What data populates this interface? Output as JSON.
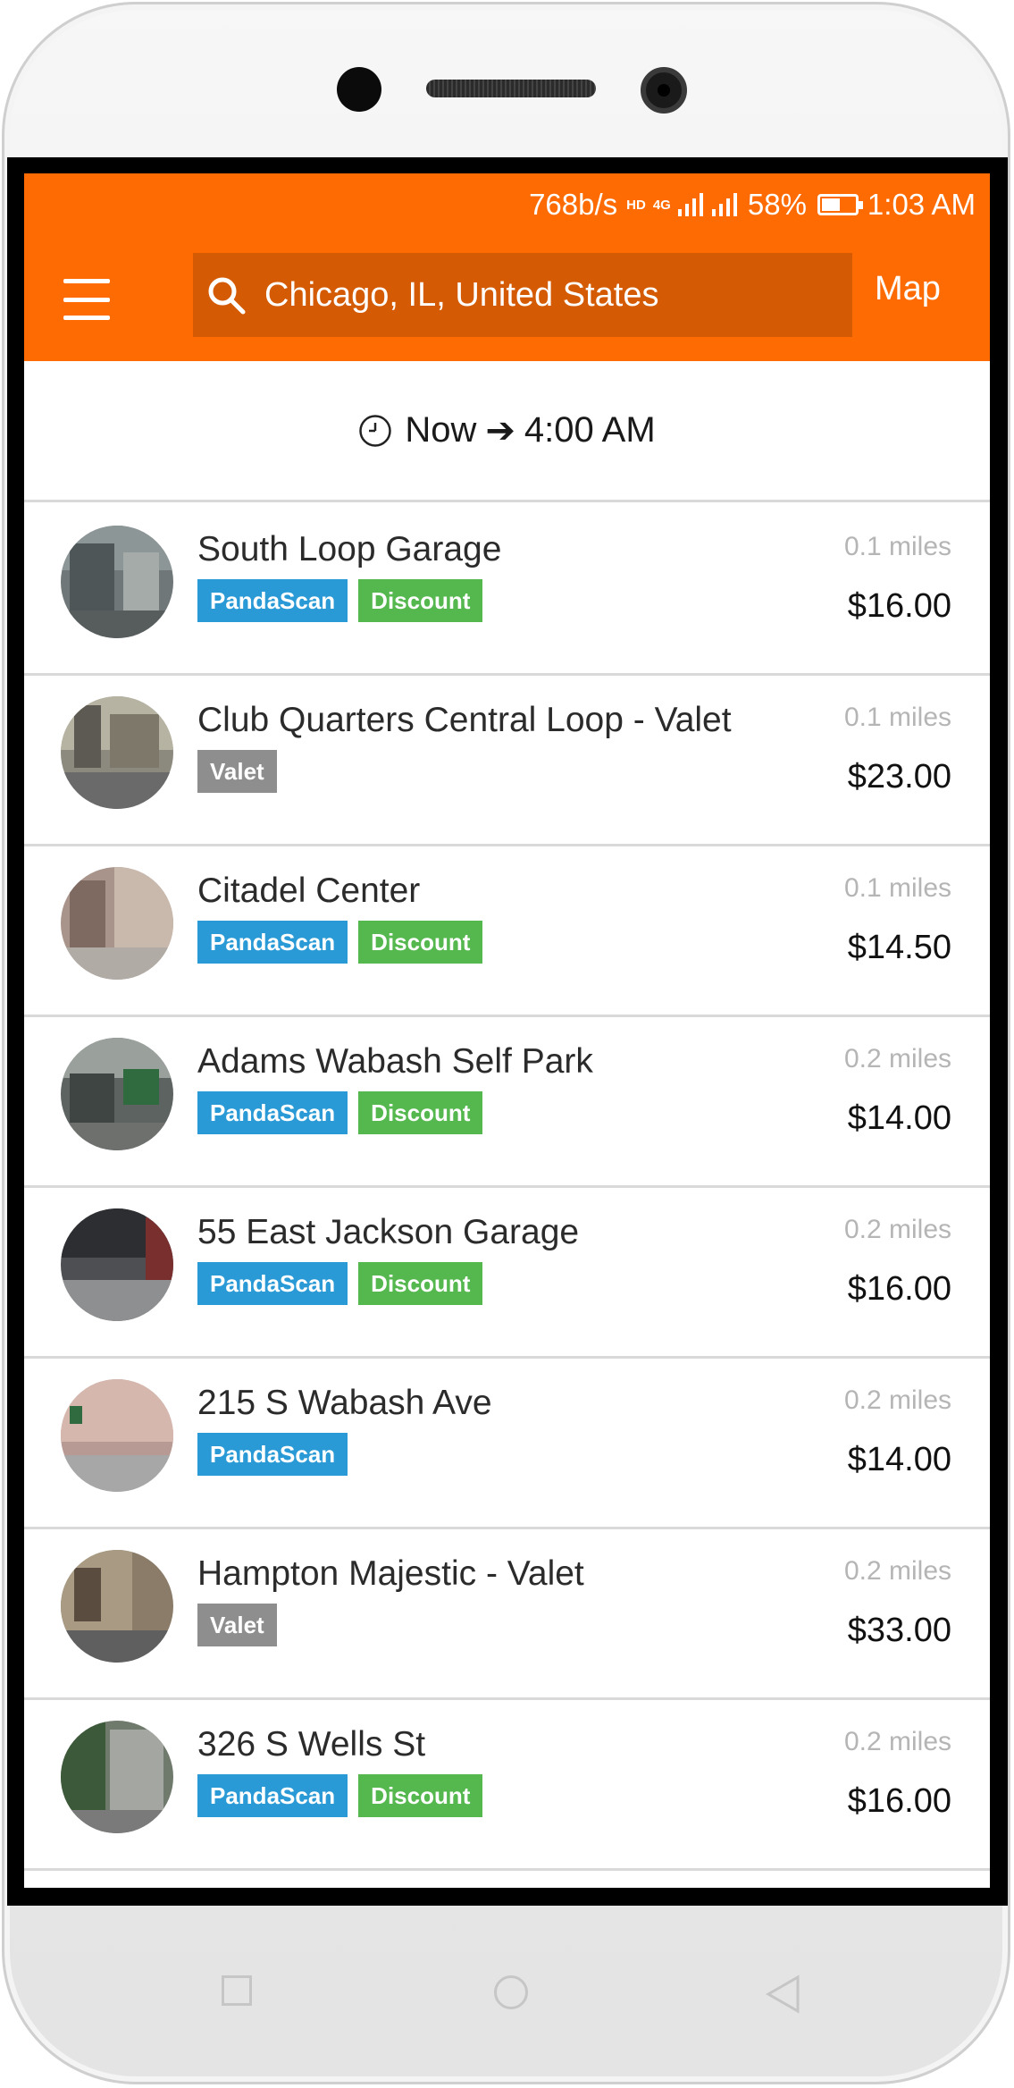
{
  "status_bar": {
    "speed": "768b/s",
    "network_hd": "HD",
    "network_type": "4G",
    "battery_percent": "58%",
    "time": "1:03 AM"
  },
  "header": {
    "search_value": "Chicago, IL, United States",
    "map_label": "Map",
    "accent_color": "#fe6b03"
  },
  "time_range": {
    "start": "Now",
    "end": "4:00 AM"
  },
  "listings": [
    {
      "name": "South Loop Garage",
      "distance": "0.1 miles",
      "price": "$16.00",
      "tags": [
        "PandaScan",
        "Discount"
      ]
    },
    {
      "name": "Club Quarters Central Loop - Valet",
      "distance": "0.1 miles",
      "price": "$23.00",
      "tags": [
        "Valet"
      ]
    },
    {
      "name": "Citadel Center",
      "distance": "0.1 miles",
      "price": "$14.50",
      "tags": [
        "PandaScan",
        "Discount"
      ]
    },
    {
      "name": "Adams Wabash Self Park",
      "distance": "0.2 miles",
      "price": "$14.00",
      "tags": [
        "PandaScan",
        "Discount"
      ]
    },
    {
      "name": "55 East Jackson Garage",
      "distance": "0.2 miles",
      "price": "$16.00",
      "tags": [
        "PandaScan",
        "Discount"
      ]
    },
    {
      "name": "215 S Wabash Ave",
      "distance": "0.2 miles",
      "price": "$14.00",
      "tags": [
        "PandaScan"
      ]
    },
    {
      "name": "Hampton Majestic - Valet",
      "distance": "0.2 miles",
      "price": "$33.00",
      "tags": [
        "Valet"
      ]
    },
    {
      "name": "326 S Wells St",
      "distance": "0.2 miles",
      "price": "$16.00",
      "tags": [
        "PandaScan",
        "Discount"
      ]
    }
  ],
  "tag_colors": {
    "PandaScan": "#2a9ad6",
    "Discount": "#55b84e",
    "Valet": "#8e8e8e"
  },
  "icons": {
    "menu": "hamburger-icon",
    "search": "search-icon",
    "time": "clock-icon",
    "arrow": "arrow-right-icon"
  }
}
